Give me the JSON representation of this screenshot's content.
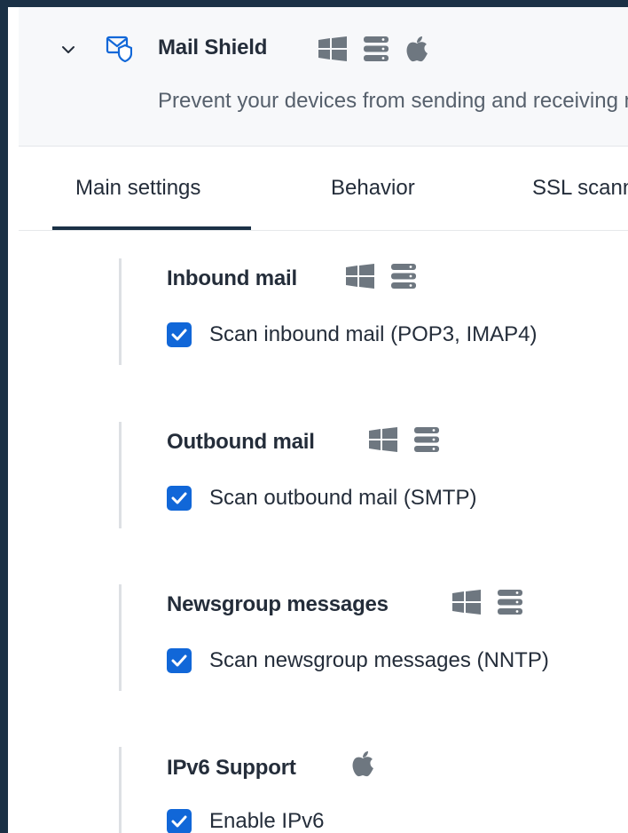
{
  "shield": {
    "title": "Mail Shield",
    "description": "Prevent your devices from sending and receiving malicious emails",
    "header_platform_icons": [
      "windows-icon",
      "server-icon",
      "apple-icon"
    ]
  },
  "tabs": [
    {
      "label": "Main settings",
      "active": true
    },
    {
      "label": "Behavior",
      "active": false
    },
    {
      "label": "SSL scanning",
      "active": false
    }
  ],
  "sections": [
    {
      "title": "Inbound mail",
      "platform_icons": [
        "windows-icon",
        "server-icon"
      ],
      "checkbox_label": "Scan inbound mail (POP3, IMAP4)",
      "checked": true
    },
    {
      "title": "Outbound mail",
      "platform_icons": [
        "windows-icon",
        "server-icon"
      ],
      "checkbox_label": "Scan outbound mail (SMTP)",
      "checked": true
    },
    {
      "title": "Newsgroup messages",
      "platform_icons": [
        "windows-icon",
        "server-icon"
      ],
      "checkbox_label": "Scan newsgroup messages (NNTP)",
      "checked": true
    },
    {
      "title": "IPv6 Support",
      "platform_icons": [
        "apple-icon"
      ],
      "checkbox_label": "Enable IPv6",
      "checked": true
    }
  ],
  "colors": {
    "background": "#1b3146",
    "accent": "#1167d8",
    "icon_gray": "#6e7780"
  }
}
